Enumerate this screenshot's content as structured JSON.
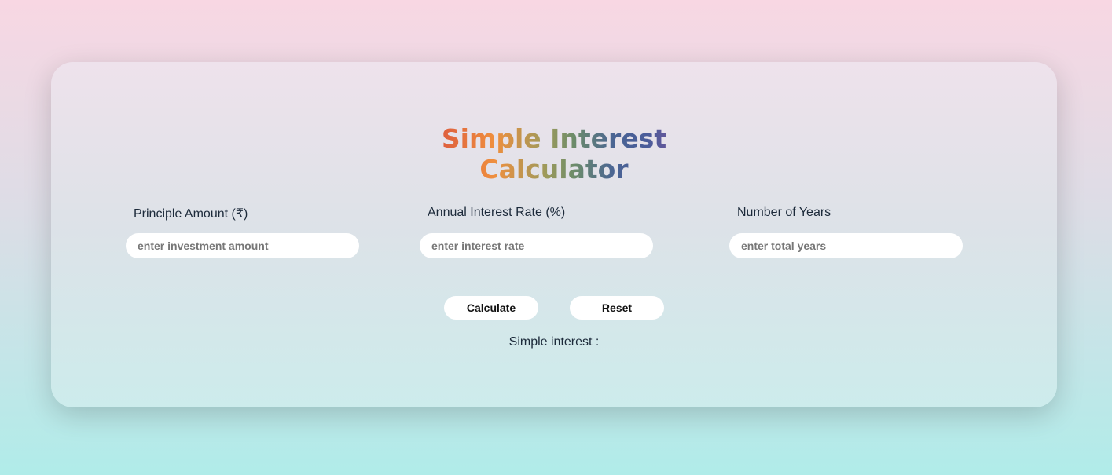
{
  "title": "Simple Interest Calculator",
  "fields": [
    {
      "label": "Principle Amount (₹)",
      "placeholder": "enter investment amount",
      "value": ""
    },
    {
      "label": "Annual Interest Rate (%)",
      "placeholder": "enter interest rate",
      "value": ""
    },
    {
      "label": "Number of Years",
      "placeholder": "enter total years",
      "value": ""
    }
  ],
  "buttons": {
    "calculate": "Calculate",
    "reset": "Reset"
  },
  "result": {
    "label": "Simple interest :"
  },
  "colors": {
    "background_top": "#f8d7e3",
    "background_bottom": "#b0ece9",
    "card": "#e6e6ec",
    "title_gradient": [
      "#c93a3a",
      "#ef8f3e",
      "#6c8c6a",
      "#4a5c9a",
      "#a24a9c"
    ]
  }
}
